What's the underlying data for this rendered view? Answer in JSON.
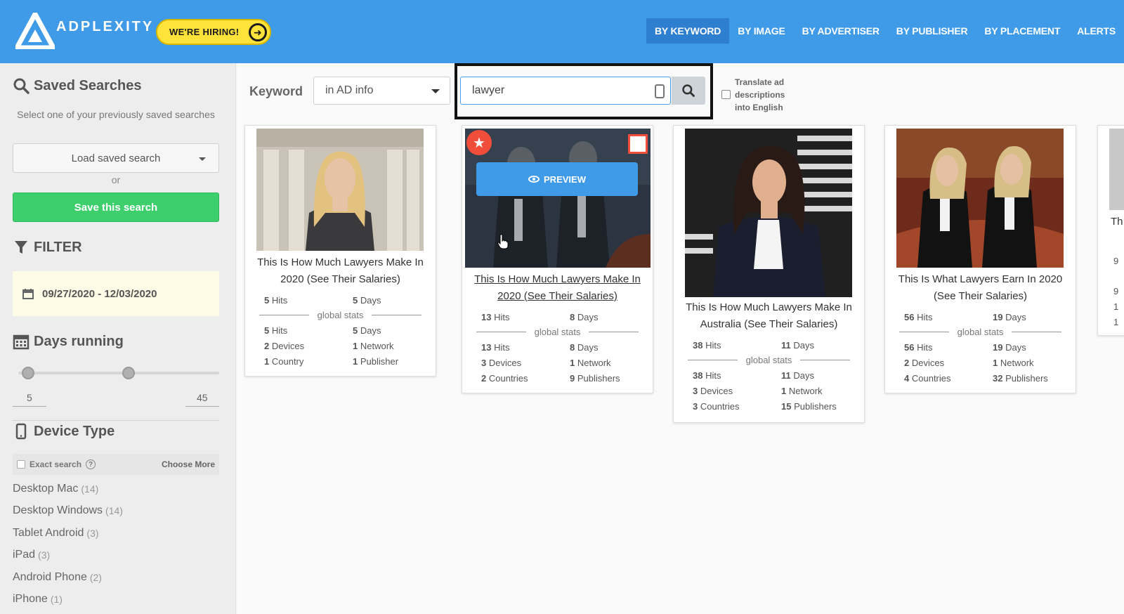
{
  "header": {
    "brand": "ADPLEXITY",
    "hiring": "WE'RE HIRING!",
    "nav": [
      {
        "label": "BY KEYWORD",
        "active": true
      },
      {
        "label": "BY IMAGE"
      },
      {
        "label": "BY ADVERTISER"
      },
      {
        "label": "BY PUBLISHER"
      },
      {
        "label": "BY PLACEMENT"
      },
      {
        "label": "ALERTS"
      }
    ]
  },
  "sidebar": {
    "saved_title": "Saved Searches",
    "saved_sub": "Select one of your previously saved searches",
    "load_label": "Load saved search",
    "or": "or",
    "save_label": "Save this search",
    "filter_title": "FILTER",
    "date_range": "09/27/2020 - 12/03/2020",
    "days_title": "Days running",
    "days_min": "5",
    "days_max": "45",
    "days_low_fraction": 0.05,
    "days_high_fraction": 0.55,
    "device_title": "Device Type",
    "exact_label": "Exact search",
    "exact_help": "?",
    "choose_more": "Choose More",
    "devices": [
      {
        "name": "Desktop Mac",
        "count": "(14)"
      },
      {
        "name": "Desktop Windows",
        "count": "(14)"
      },
      {
        "name": "Tablet Android",
        "count": "(3)"
      },
      {
        "name": "iPad",
        "count": "(3)"
      },
      {
        "name": "Android Phone",
        "count": "(2)"
      },
      {
        "name": "iPhone",
        "count": "(1)"
      }
    ]
  },
  "search": {
    "keyword_label": "Keyword",
    "scope": "in AD info",
    "query": "lawyer",
    "translate_label": "Translate ad descriptions into English"
  },
  "global_stats_label": "global stats",
  "cards": [
    {
      "title": "This Is How Much Lawyers Make In 2020 (See Their Salaries)",
      "hits": "5",
      "days": "5",
      "g_hits": "5",
      "g_days": "5",
      "devices": "2",
      "devices_label": "Devices",
      "networks": "1",
      "networks_label": "Network",
      "countries": "1",
      "countries_label": "Country",
      "publishers": "1",
      "publishers_label": "Publisher"
    },
    {
      "title": "This Is How Much Lawyers Make In 2020 (See Their Salaries)",
      "hits": "13",
      "days": "8",
      "g_hits": "13",
      "g_days": "8",
      "devices": "3",
      "devices_label": "Devices",
      "networks": "1",
      "networks_label": "Network",
      "countries": "2",
      "countries_label": "Countries",
      "publishers": "9",
      "publishers_label": "Publishers",
      "preview_label": "PREVIEW"
    },
    {
      "title": "This Is How Much Lawyers Make In Australia (See Their Salaries)",
      "hits": "38",
      "days": "11",
      "g_hits": "38",
      "g_days": "11",
      "devices": "3",
      "devices_label": "Devices",
      "networks": "1",
      "networks_label": "Network",
      "countries": "3",
      "countries_label": "Countries",
      "publishers": "15",
      "publishers_label": "Publishers"
    },
    {
      "title": "This Is What Lawyers Earn In 2020 (See Their Salaries)",
      "hits": "56",
      "days": "19",
      "g_hits": "56",
      "g_days": "19",
      "devices": "2",
      "devices_label": "Devices",
      "networks": "1",
      "networks_label": "Network",
      "countries": "4",
      "countries_label": "Countries",
      "publishers": "32",
      "publishers_label": "Publishers"
    }
  ],
  "labels": {
    "hits": "Hits",
    "days": "Days"
  },
  "partial_card": {
    "title_fragment": "Th",
    "stats": [
      "9",
      "9",
      "1",
      "1"
    ]
  }
}
